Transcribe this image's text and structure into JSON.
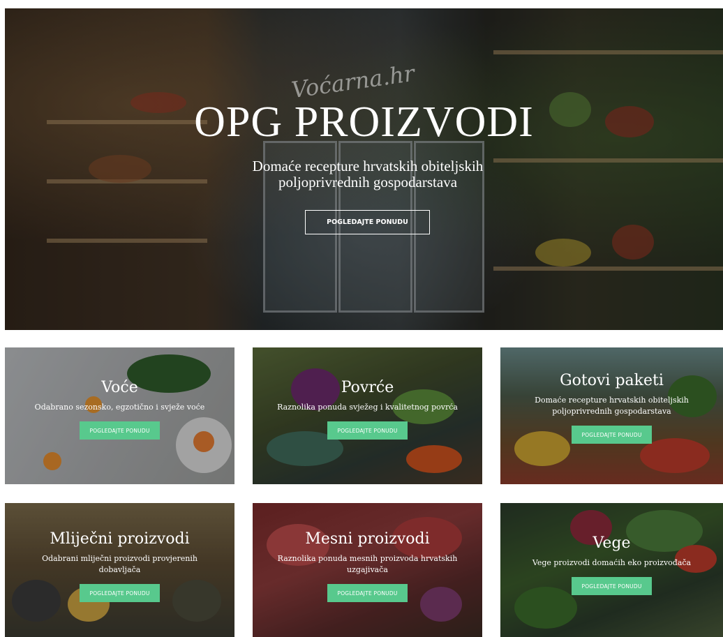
{
  "hero": {
    "brand": "Voćarna.hr",
    "title": "OPG PROIZVODI",
    "subtitle": "Domaće recepture hrvatskih obiteljskih poljoprivrednih gospodarstava",
    "button_label": "POGLEDAJTE PONUDU"
  },
  "categories": [
    {
      "title": "Voće",
      "description": "Odabrano sezonsko, egzotično i svježe voće",
      "button_label": "POGLEDAJTE PONUDU"
    },
    {
      "title": "Povrće",
      "description": "Raznolika ponuda svježeg i kvalitetnog povrća",
      "button_label": "POGLEDAJTE PONUDU"
    },
    {
      "title": "Gotovi paketi",
      "description": "Domaće recepture hrvatskih obiteljskih poljoprivrednih gospodarstava",
      "button_label": "POGLEDAJTE PONUDU"
    },
    {
      "title": "Mliječni proizvodi",
      "description": "Odabrani mliječni proizvodi provjerenih dobavljača",
      "button_label": "POGLEDAJTE PONUDU"
    },
    {
      "title": "Mesni proizvodi",
      "description": "Raznolika ponuda mesnih proizvoda hrvatskih uzgajivača",
      "button_label": "POGLEDAJTE PONUDU"
    },
    {
      "title": "Vege",
      "description": "Vege proizvodi domaćih eko proizvođača",
      "button_label": "POGLEDAJTE PONUDU"
    }
  ],
  "colors": {
    "button_green": "#58c98d",
    "overlay": "rgba(0,0,0,0.35)"
  }
}
